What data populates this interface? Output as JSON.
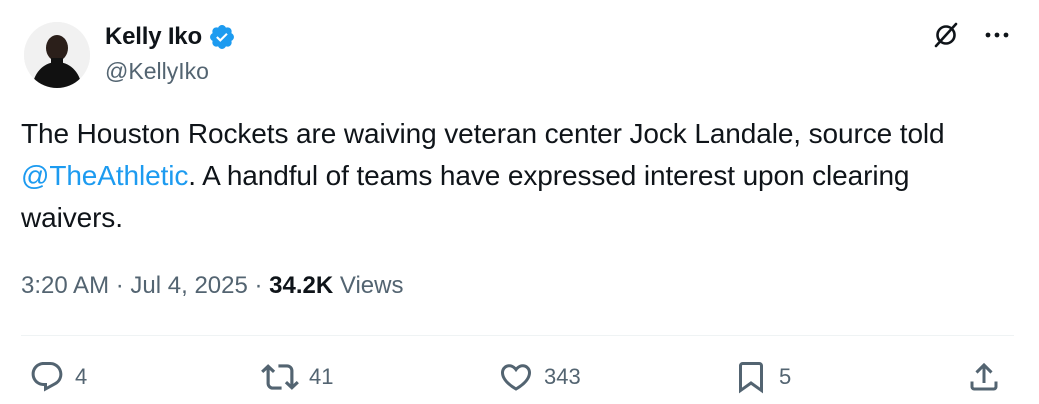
{
  "author": {
    "display_name": "Kelly Iko",
    "handle": "@KellyIko",
    "verified": true,
    "avatar_icon": "avatar-photo"
  },
  "header_actions": {
    "grok_icon": "grok-icon",
    "more_icon": "more-icon"
  },
  "tweet": {
    "text_before": "The Houston Rockets are waiving veteran center Jock Landale, source told ",
    "mention": "@TheAthletic",
    "text_after": ". A handful of teams have expressed interest upon clearing waivers."
  },
  "meta": {
    "time": "3:20 AM",
    "sep1": "·",
    "date": "Jul 4, 2025",
    "sep2": "·",
    "views_count": "34.2K",
    "views_label": "Views"
  },
  "actions": {
    "replies": "4",
    "reposts": "41",
    "likes": "343",
    "bookmarks": "5"
  },
  "colors": {
    "text": "#0f1419",
    "secondary": "#536471",
    "link": "#1d9bf0",
    "verified": "#1d9bf0",
    "divider": "#eff3f4"
  }
}
